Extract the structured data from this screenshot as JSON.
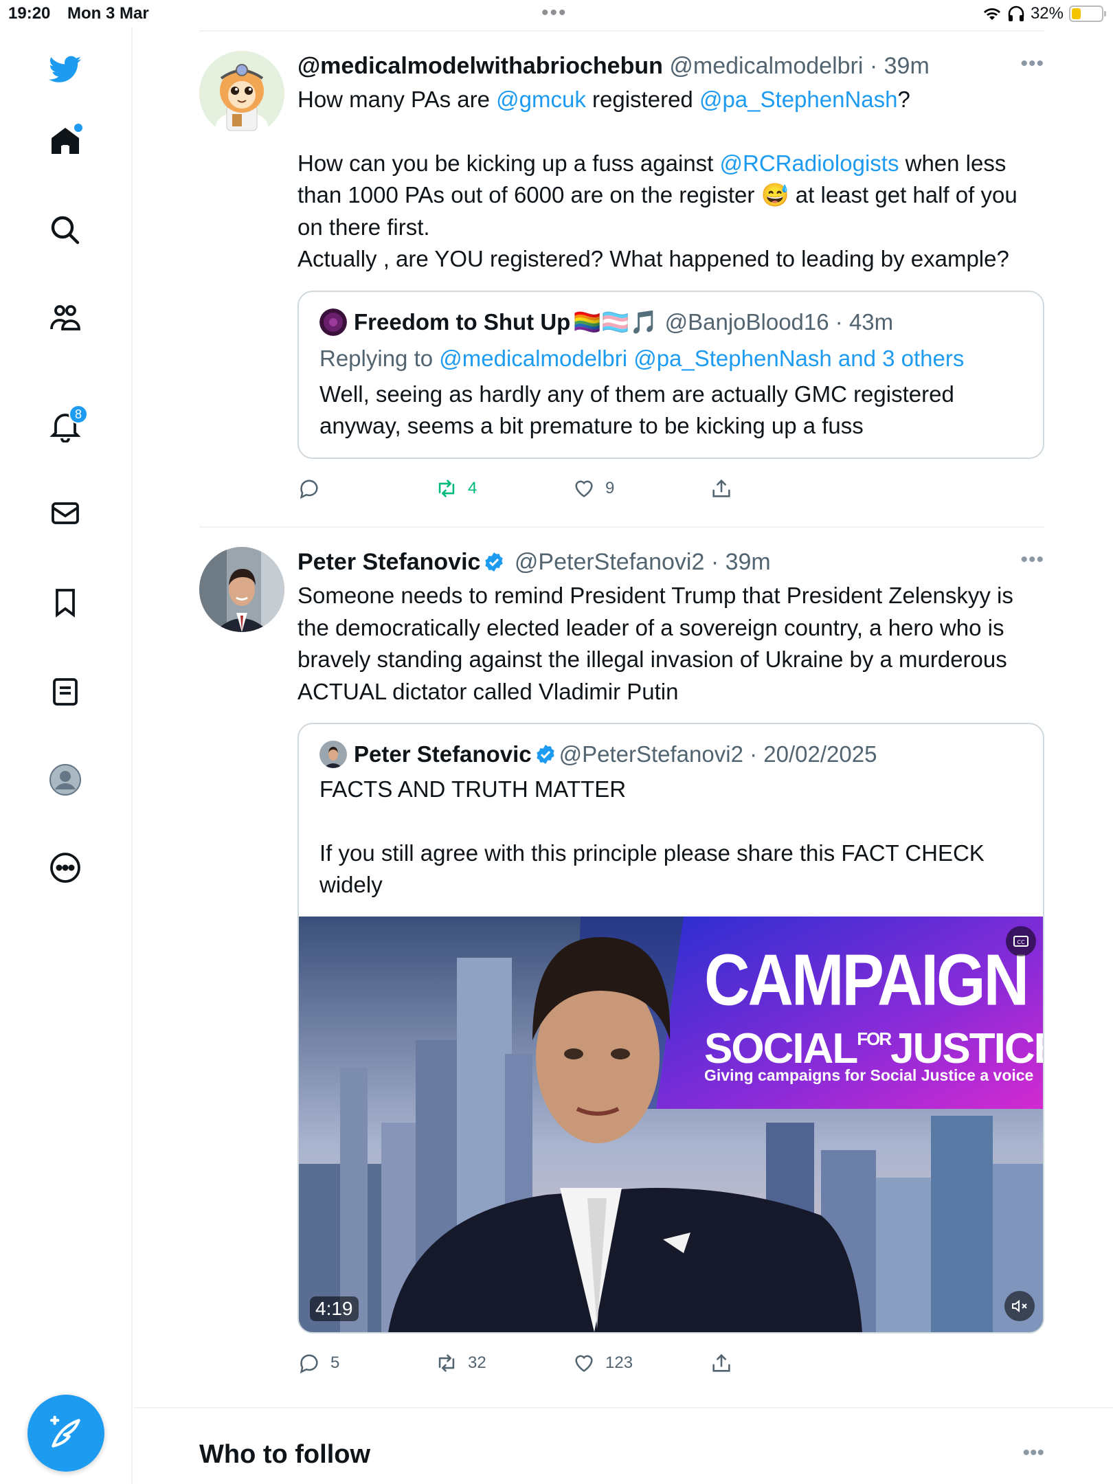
{
  "status_bar": {
    "time": "19:20",
    "date": "Mon 3 Mar",
    "battery": "32%",
    "battery_level": 0.32
  },
  "sidebar": {
    "notifications_badge": "8",
    "items": [
      {
        "name": "twitter-logo"
      },
      {
        "name": "home"
      },
      {
        "name": "search"
      },
      {
        "name": "communities"
      },
      {
        "name": "notifications"
      },
      {
        "name": "messages"
      },
      {
        "name": "bookmarks"
      },
      {
        "name": "lists"
      },
      {
        "name": "profile"
      },
      {
        "name": "more"
      }
    ]
  },
  "tweets": [
    {
      "name": "@medicalmodelwithabriochebun",
      "handle": "@medicalmodelbri",
      "time": "· 39m",
      "text": {
        "l1a": "How many PAs are ",
        "l1b": "@gmcuk",
        "l1c": " registered ",
        "l1d": "@pa_StephenNash",
        "l1e": "?",
        "l2a": "How can you be kicking up a fuss against ",
        "l2b": "@RCRadiologists",
        "l2c": " when less than 1000 PAs out of 6000 are on the register ",
        "l2emoji": "😅",
        "l2d": " at least get half of you on there first.",
        "l3": "Actually , are YOU registered? What happened to leading by example?"
      },
      "quote": {
        "name": "Freedom to Shut Up",
        "flags": "🏳️‍🌈🏳️‍⚧️🎵",
        "handle": "@BanjoBlood16",
        "time": "· 43m",
        "replying_prefix": "Replying to ",
        "replying_to": "@medicalmodelbri @pa_StephenNash and 3 others",
        "text": "Well, seeing as hardly any of them are actually GMC registered anyway, seems a bit premature to be kicking up a fuss"
      },
      "replies": "",
      "retweets": "4",
      "likes": "9",
      "retweet_color": "#00ba7c"
    },
    {
      "name": "Peter Stefanovic",
      "handle": "@PeterStefanovi2",
      "time": "· 39m",
      "text": "Someone needs to remind President Trump that President Zelenskyy is the democratically elected leader of a sovereign country, a hero who is bravely standing against the illegal invasion of Ukraine by a murderous ACTUAL dictator called Vladimir Putin",
      "quote": {
        "name": "Peter Stefanovic",
        "handle": "@PeterStefanovi2",
        "time": "· 20/02/2025",
        "text_l1": "FACTS AND TRUTH MATTER",
        "text_l2": "If you still agree with this principle please share this FACT CHECK widely",
        "video": {
          "title": "CAMPAIGN",
          "sub_a": "SOCIAL",
          "sub_for": "FOR",
          "sub_b": "JUSTICE",
          "tagline": "Giving campaigns for Social Justice a voice",
          "duration": "4:19"
        }
      },
      "replies": "5",
      "retweets": "32",
      "likes": "123"
    }
  ],
  "who_to_follow": "Who to follow",
  "colors": {
    "accent": "#1d9bf0",
    "text": "#0f1419",
    "muted": "#536471"
  }
}
